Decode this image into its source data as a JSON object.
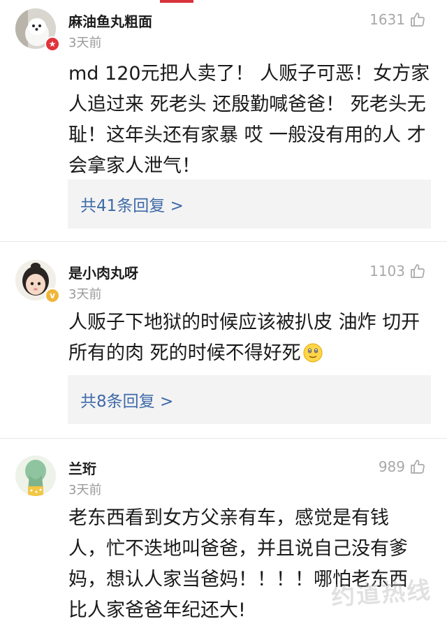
{
  "comments": [
    {
      "username": "麻油鱼丸粗面",
      "time": "3天前",
      "likes": "1631",
      "lines": [
        "md 120元把人卖了！ 人贩子可恶！女方家",
        "人追过来 死老头 还殷勤喊爸爸！ 死老头无",
        "耻！这年头还有家暴 哎 一般没有用的人 才",
        "会拿家人泄气！"
      ],
      "replies": "共41条回复 >",
      "badge_icon": "red-star-badge-icon"
    },
    {
      "username": "是小肉丸呀",
      "time": "3天前",
      "likes": "1103",
      "lines": [
        "人贩子下地狱的时候应该被扒皮 油炸 切开",
        "所有的肉  死的时候不得好死"
      ],
      "replies": "共8条回复 >",
      "badge_icon": "verified-v-badge-icon"
    },
    {
      "username": "兰珩",
      "time": "3天前",
      "likes": "989",
      "lines": [
        "老东西看到女方父亲有车，感觉是有钱",
        "人，忙不迭地叫爸爸，并且说自己没有爹",
        "妈，想认人家当爸妈！！！！哪怕老东西",
        "比人家爸爸年纪还大!"
      ]
    }
  ],
  "watermark": "约道热线",
  "colors": {
    "accent": "#d8333b",
    "link": "#3e6aa8",
    "reply_bg": "#f3f3f3"
  }
}
